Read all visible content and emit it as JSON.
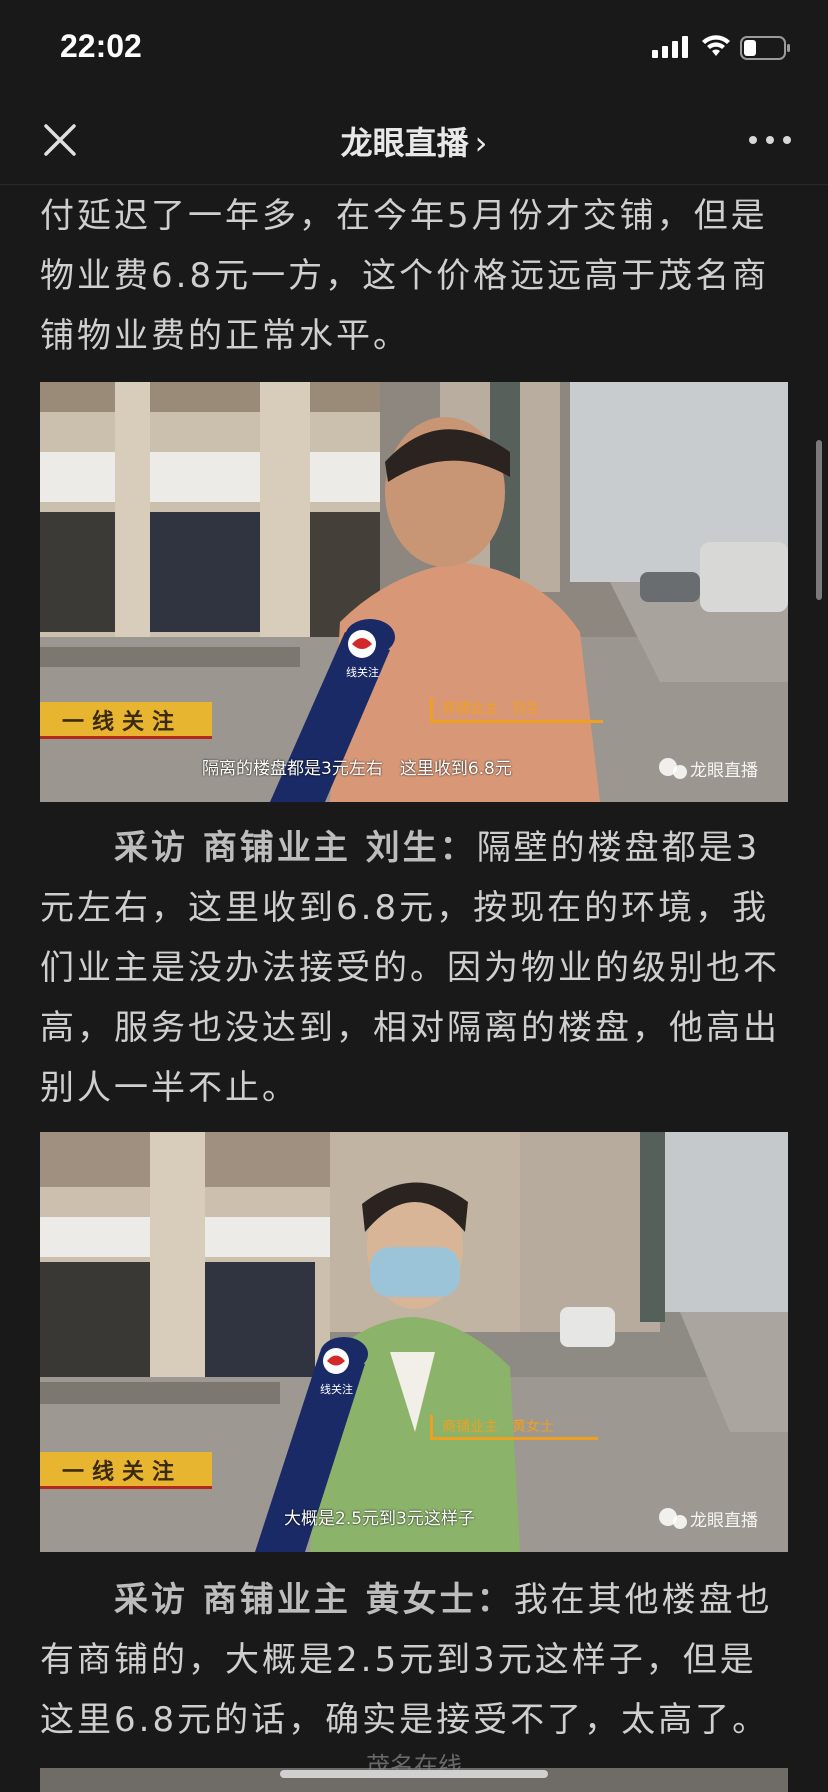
{
  "status_bar": {
    "time": "22:02"
  },
  "nav": {
    "title": "龙眼直播",
    "chevron": "›"
  },
  "article": {
    "paragraph_1": "付延迟了一年多，在今年5月份才交铺，但是物业费6.8元一方，这个价格远远高于茂名商铺物业费的正常水平。",
    "paragraph_2_lead": "采访 商铺业主 刘生：",
    "paragraph_2_text": "隔壁的楼盘都是3元左右，这里收到6.8元，按现在的环境，我们业主是没办法接受的。因为物业的级别也不高，服务也没达到，相对隔离的楼盘，他高出别人一半不止。",
    "paragraph_3_lead": "采访 商铺业主 黄女士：",
    "paragraph_3_text": "我在其他楼盘也有商铺的，大概是2.5元到3元这样子，但是这里6.8元的话，确实是接受不了，太高了。"
  },
  "frame_1": {
    "banner": "一线关注",
    "mic_label": "线关注",
    "name_tag": "商铺业主　刘生",
    "subtitle": "隔离的楼盘都是3元左右　这里收到6.8元",
    "watermark": "龙眼直播"
  },
  "frame_2": {
    "banner": "一线关注",
    "mic_label": "线关注",
    "name_tag": "商铺业主　黄女士",
    "subtitle": "大概是2.5元到3元这样子",
    "watermark": "龙眼直播"
  },
  "footer": {
    "watermark": "茂名在线"
  },
  "colors": {
    "background": "#191919",
    "text": "#cfcfcf",
    "banner_gold": "#e8b531",
    "name_tag_orange": "#f0a020"
  },
  "icons": {
    "close": "close-icon",
    "more": "more-icon",
    "signal": "signal-icon",
    "wifi": "wifi-icon",
    "battery": "battery-icon"
  }
}
